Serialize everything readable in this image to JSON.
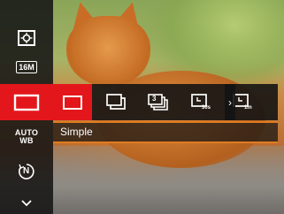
{
  "sidebar": {
    "items": [
      {
        "icon": "metering-icon"
      },
      {
        "icon": "resolution-icon",
        "text": "16M"
      },
      {
        "icon": "continuous-shot-icon",
        "selected": true
      },
      {
        "icon": "white-balance-icon",
        "text_line1": "AUTO",
        "text_line2": "WB"
      },
      {
        "icon": "iso-icon",
        "text": "N"
      },
      {
        "icon": "chevron-down-icon"
      }
    ]
  },
  "mode_bar": {
    "options": [
      {
        "icon": "single-shot-icon",
        "selected": true
      },
      {
        "icon": "continuous-shot-icon"
      },
      {
        "icon": "burst-3-icon",
        "text": "3"
      },
      {
        "icon": "timelapse-30s-icon",
        "text": "30s"
      },
      {
        "icon": "timelapse-1m-icon",
        "text": "1m"
      }
    ],
    "more_arrow": "›"
  },
  "label_bar": {
    "text": "Simple"
  },
  "colors": {
    "accent": "#e3171b",
    "rule": "#e07b20"
  }
}
